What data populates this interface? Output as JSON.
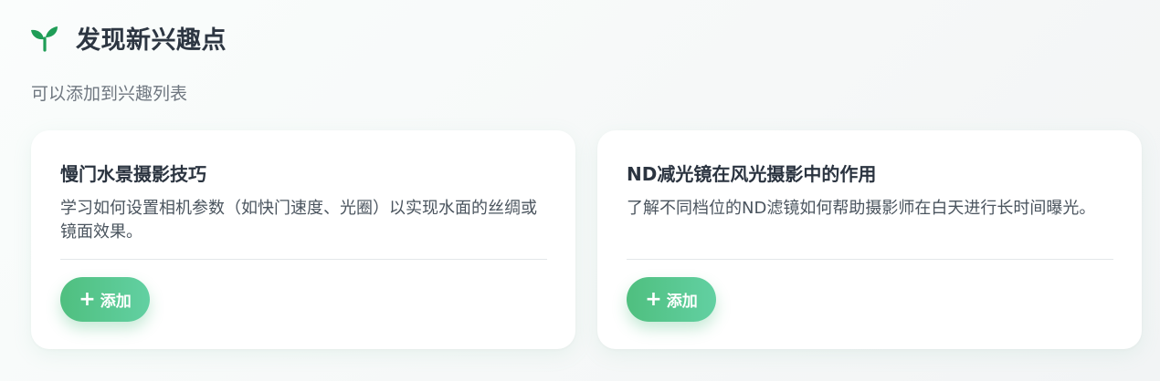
{
  "header": {
    "icon": "sprout-icon",
    "title": "发现新兴趣点",
    "subtitle": "可以添加到兴趣列表"
  },
  "cards": [
    {
      "title": "慢门水景摄影技巧",
      "description": "学习如何设置相机参数（如快门速度、光圈）以实现水面的丝绸或镜面效果。",
      "button_icon": "plus-icon",
      "button_symbol": "+",
      "button_label": "添加"
    },
    {
      "title": "ND减光镜在风光摄影中的作用",
      "description": "了解不同档位的ND滤镜如何帮助摄影师在白天进行长时间曝光。",
      "button_icon": "plus-icon",
      "button_symbol": "+",
      "button_label": "添加"
    }
  ],
  "colors": {
    "accent_start": "#4fbf7f",
    "accent_end": "#62d0a2",
    "icon_green": "#1f9d57"
  }
}
